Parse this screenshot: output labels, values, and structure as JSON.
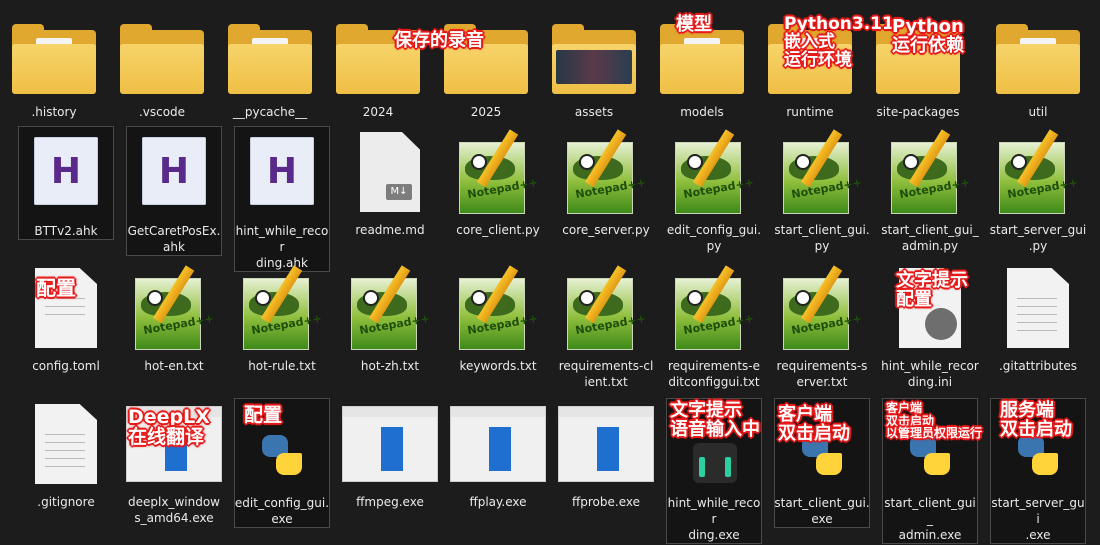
{
  "items": [
    {
      "label": ".history",
      "icon": "folder-icon"
    },
    {
      "label": ".vscode",
      "icon": "folder-icon"
    },
    {
      "label": "__pycache__",
      "icon": "folder-icon"
    },
    {
      "label": "2024",
      "icon": "folder-icon"
    },
    {
      "label": "2025",
      "icon": "folder-icon"
    },
    {
      "label": "assets",
      "icon": "folder-icon"
    },
    {
      "label": "models",
      "icon": "folder-icon"
    },
    {
      "label": "runtime",
      "icon": "folder-icon"
    },
    {
      "label": "site-packages",
      "icon": "folder-icon"
    },
    {
      "label": "util",
      "icon": "folder-icon"
    },
    {
      "label": "BTTv2.ahk",
      "icon": "ahk-file-icon"
    },
    {
      "label": "GetCaretPosEx.\nahk",
      "icon": "ahk-file-icon"
    },
    {
      "label": "hint_while_recor\nding.ahk",
      "icon": "ahk-file-icon"
    },
    {
      "label": "readme.md",
      "icon": "markdown-file-icon"
    },
    {
      "label": "core_client.py",
      "icon": "notepad-plus-plus-icon"
    },
    {
      "label": "core_server.py",
      "icon": "notepad-plus-plus-icon"
    },
    {
      "label": "edit_config_gui.\npy",
      "icon": "notepad-plus-plus-icon"
    },
    {
      "label": "start_client_gui.\npy",
      "icon": "notepad-plus-plus-icon"
    },
    {
      "label": "start_client_gui_\nadmin.py",
      "icon": "notepad-plus-plus-icon"
    },
    {
      "label": "start_server_gui\n.py",
      "icon": "notepad-plus-plus-icon"
    },
    {
      "label": "config.toml",
      "icon": "document-icon"
    },
    {
      "label": "hot-en.txt",
      "icon": "notepad-plus-plus-icon"
    },
    {
      "label": "hot-rule.txt",
      "icon": "notepad-plus-plus-icon"
    },
    {
      "label": "hot-zh.txt",
      "icon": "notepad-plus-plus-icon"
    },
    {
      "label": "keywords.txt",
      "icon": "notepad-plus-plus-icon"
    },
    {
      "label": "requirements-cl\nient.txt",
      "icon": "notepad-plus-plus-icon"
    },
    {
      "label": "requirements-e\nditconfiggui.txt",
      "icon": "notepad-plus-plus-icon"
    },
    {
      "label": "requirements-s\nerver.txt",
      "icon": "notepad-plus-plus-icon"
    },
    {
      "label": "hint_while_recor\nding.ini",
      "icon": "settings-file-icon"
    },
    {
      "label": ".gitattributes",
      "icon": "document-icon"
    },
    {
      "label": ".gitignore",
      "icon": "document-icon"
    },
    {
      "label": "deeplx_window\ns_amd64.exe",
      "icon": "exe-window-icon"
    },
    {
      "label": "edit_config_gui.\nexe",
      "icon": "python-icon"
    },
    {
      "label": "ffmpeg.exe",
      "icon": "exe-window-icon"
    },
    {
      "label": "ffplay.exe",
      "icon": "exe-window-icon"
    },
    {
      "label": "ffprobe.exe",
      "icon": "exe-window-icon"
    },
    {
      "label": "hint_while_recor\nding.exe",
      "icon": "dark-app-icon"
    },
    {
      "label": "start_client_gui.\nexe",
      "icon": "python-icon"
    },
    {
      "label": "start_client_gui_\nadmin.exe",
      "icon": "python-icon"
    },
    {
      "label": "start_server_gui\n.exe",
      "icon": "python-icon"
    }
  ],
  "annotations": {
    "a2024": "保存的录音",
    "models": "模型",
    "runtime": "Python3.11\n嵌入式\n运行环境",
    "site": "Python\n运行依赖",
    "config": "配置",
    "ini": "文字提示\n配置",
    "deeplx": "DeepLX\n在线翻译",
    "editcfg": "配置",
    "hint": "文字提示\n语音输入中",
    "client": "客户端\n双击启动",
    "admin": "客户端\n双击启动\n以管理员权限运行",
    "server": "服务端\n双击启动"
  },
  "md_badge": "M↓",
  "npp_text": "Notepad++",
  "ahk_letter": "H",
  "colors": {
    "background": "#1c1c1c",
    "annotation": "#e61b1b",
    "folder": "#efbf45"
  }
}
